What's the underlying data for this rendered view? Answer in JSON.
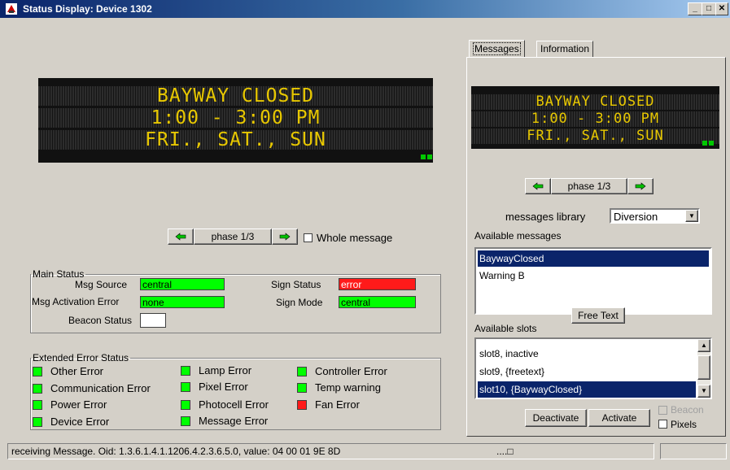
{
  "window": {
    "title": "Status Display: Device 1302"
  },
  "main_sign": {
    "lines": [
      "BAYWAY CLOSED",
      "1:00 - 3:00 PM",
      "FRI., SAT., SUN"
    ]
  },
  "main_nav": {
    "phase_label": "phase 1/3",
    "whole_message_label": "Whole message",
    "whole_message_checked": false
  },
  "main_status": {
    "legend": "Main Status",
    "msg_source_label": "Msg Source",
    "msg_source_value": "central",
    "msg_activation_error_label": "Msg Activation Error",
    "msg_activation_error_value": "none",
    "beacon_status_label": "Beacon Status",
    "beacon_status_value": "",
    "sign_status_label": "Sign Status",
    "sign_status_value": "error",
    "sign_mode_label": "Sign Mode",
    "sign_mode_value": "central",
    "colors": {
      "ok": "#00ff00",
      "error": "#ff1a1a"
    }
  },
  "extended": {
    "legend": "Extended Error Status",
    "items": [
      {
        "label": "Other Error",
        "status": "ok"
      },
      {
        "label": "Communication Error",
        "status": "ok"
      },
      {
        "label": "Power Error",
        "status": "ok"
      },
      {
        "label": "Device Error",
        "status": "ok"
      },
      {
        "label": "Lamp Error",
        "status": "ok"
      },
      {
        "label": "Pixel Error",
        "status": "ok"
      },
      {
        "label": "Photocell Error",
        "status": "ok"
      },
      {
        "label": "Message Error",
        "status": "ok"
      },
      {
        "label": "Controller Error",
        "status": "ok"
      },
      {
        "label": "Temp warning",
        "status": "ok"
      },
      {
        "label": "Fan Error",
        "status": "error"
      }
    ]
  },
  "tabs": {
    "messages": "Messages",
    "information": "Information"
  },
  "preview": {
    "lines": [
      "BAYWAY CLOSED",
      "1:00 - 3:00 PM",
      "FRI., SAT., SUN"
    ],
    "phase_label": "phase 1/3"
  },
  "library": {
    "label": "messages library",
    "selected": "Diversion"
  },
  "available_messages": {
    "label": "Available messages",
    "items": [
      "BaywayClosed",
      "Warning B"
    ],
    "selected_index": 0
  },
  "free_text_label": "Free Text",
  "available_slots": {
    "label": "Available slots",
    "items": [
      "slot8, inactive",
      "slot9, {freetext}",
      "slot10, {BaywayClosed}"
    ],
    "selected_index": 2
  },
  "actions": {
    "deactivate": "Deactivate",
    "activate": "Activate",
    "beacon_label": "Beacon",
    "pixels_label": "Pixels"
  },
  "status_bar": {
    "message": "receiving Message. Oid: 1.3.6.1.4.1.1206.4.2.3.6.5.0, value:  04 00 01 9E 8D",
    "progress": "....□"
  }
}
